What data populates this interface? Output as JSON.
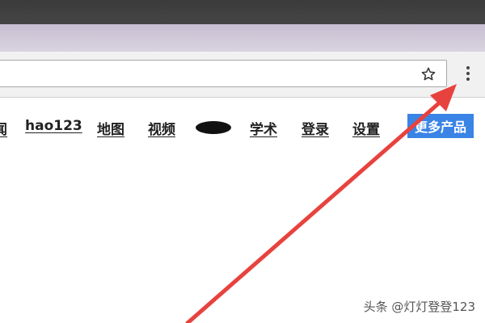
{
  "nav": {
    "items": [
      {
        "label": "闻"
      },
      {
        "label": "hao123"
      },
      {
        "label": "地图"
      },
      {
        "label": "视频"
      },
      {
        "label": "学术"
      },
      {
        "label": "登录"
      },
      {
        "label": "设置"
      }
    ],
    "more_products_label": "更多产品"
  },
  "toolbar": {
    "bookmark_icon": "star-icon",
    "menu_icon": "kebab-menu-icon"
  },
  "annotation": {
    "arrow_color": "#e8423e"
  },
  "watermark": "头条 @灯灯登登123",
  "colors": {
    "accent": "#3a84e6"
  }
}
